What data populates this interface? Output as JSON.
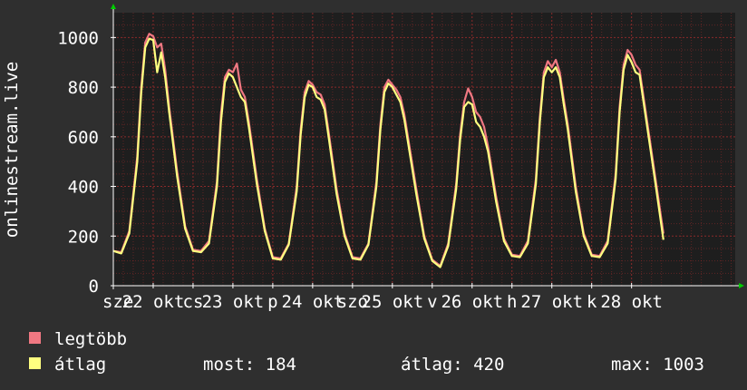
{
  "chart_data": {
    "type": "line",
    "ylabel": "onlinestream.live",
    "ylim": [
      0,
      1100
    ],
    "yticks": [
      0,
      200,
      400,
      600,
      800,
      1000
    ],
    "xlim": [
      0,
      7.8
    ],
    "x_tick_labels": [
      {
        "x": 0.0,
        "label": "sze"
      },
      {
        "x": 0.5,
        "label": "22 okt"
      },
      {
        "x": 1.0,
        "label": "cs"
      },
      {
        "x": 1.5,
        "label": "23 okt"
      },
      {
        "x": 2.0,
        "label": "p"
      },
      {
        "x": 2.5,
        "label": "24 okt"
      },
      {
        "x": 3.0,
        "label": "szo"
      },
      {
        "x": 3.5,
        "label": "25 okt"
      },
      {
        "x": 4.0,
        "label": "v"
      },
      {
        "x": 4.5,
        "label": "26 okt"
      },
      {
        "x": 5.0,
        "label": "h"
      },
      {
        "x": 5.5,
        "label": "27 okt"
      },
      {
        "x": 6.0,
        "label": "k"
      },
      {
        "x": 6.5,
        "label": "28 okt"
      }
    ],
    "grid": true,
    "colors": {
      "background": "#2f2f2f",
      "plot": "#1e1e1e",
      "grid": "#8a2a2a",
      "axis": "#ffffff",
      "arrow": "#00cc00"
    },
    "series": [
      {
        "name": "legtöbb",
        "color": "#f07882",
        "x": [
          0,
          0.1,
          0.2,
          0.3,
          0.35,
          0.4,
          0.45,
          0.5,
          0.55,
          0.6,
          0.65,
          0.7,
          0.8,
          0.9,
          1.0,
          1.1,
          1.2,
          1.3,
          1.35,
          1.4,
          1.45,
          1.5,
          1.55,
          1.6,
          1.65,
          1.7,
          1.8,
          1.9,
          2.0,
          2.1,
          2.2,
          2.3,
          2.35,
          2.4,
          2.45,
          2.5,
          2.55,
          2.6,
          2.65,
          2.7,
          2.8,
          2.9,
          3.0,
          3.1,
          3.2,
          3.3,
          3.35,
          3.4,
          3.45,
          3.5,
          3.55,
          3.6,
          3.65,
          3.7,
          3.8,
          3.9,
          4.0,
          4.1,
          4.2,
          4.3,
          4.35,
          4.4,
          4.45,
          4.5,
          4.55,
          4.6,
          4.65,
          4.7,
          4.8,
          4.9,
          5.0,
          5.1,
          5.2,
          5.3,
          5.35,
          5.4,
          5.45,
          5.5,
          5.55,
          5.6,
          5.65,
          5.7,
          5.8,
          5.9,
          6.0,
          6.1,
          6.2,
          6.3,
          6.35,
          6.4,
          6.45,
          6.5,
          6.55,
          6.6,
          6.65,
          6.7,
          6.8,
          6.9
        ],
        "y": [
          140,
          135,
          220,
          520,
          800,
          980,
          1015,
          1005,
          960,
          975,
          870,
          720,
          460,
          240,
          145,
          140,
          180,
          420,
          690,
          840,
          870,
          860,
          895,
          790,
          760,
          660,
          430,
          230,
          115,
          110,
          170,
          400,
          630,
          780,
          825,
          810,
          780,
          770,
          730,
          620,
          390,
          210,
          115,
          110,
          170,
          420,
          650,
          800,
          830,
          810,
          790,
          760,
          690,
          590,
          390,
          200,
          105,
          80,
          170,
          410,
          610,
          740,
          795,
          760,
          700,
          680,
          640,
          560,
          360,
          190,
          125,
          120,
          180,
          430,
          680,
          860,
          905,
          880,
          910,
          860,
          750,
          650,
          400,
          210,
          125,
          120,
          180,
          450,
          720,
          890,
          950,
          930,
          890,
          870,
          760,
          650,
          430,
          210
        ]
      },
      {
        "name": "átlag",
        "color": "#ffff80",
        "x": [
          0,
          0.1,
          0.2,
          0.3,
          0.35,
          0.4,
          0.45,
          0.5,
          0.55,
          0.6,
          0.65,
          0.7,
          0.8,
          0.9,
          1.0,
          1.1,
          1.2,
          1.3,
          1.35,
          1.4,
          1.45,
          1.5,
          1.55,
          1.6,
          1.65,
          1.7,
          1.8,
          1.9,
          2.0,
          2.1,
          2.2,
          2.3,
          2.35,
          2.4,
          2.45,
          2.5,
          2.55,
          2.6,
          2.65,
          2.7,
          2.8,
          2.9,
          3.0,
          3.1,
          3.2,
          3.3,
          3.35,
          3.4,
          3.45,
          3.5,
          3.55,
          3.6,
          3.65,
          3.7,
          3.8,
          3.9,
          4.0,
          4.1,
          4.2,
          4.3,
          4.35,
          4.4,
          4.45,
          4.5,
          4.55,
          4.6,
          4.65,
          4.7,
          4.8,
          4.9,
          5.0,
          5.1,
          5.2,
          5.3,
          5.35,
          5.4,
          5.45,
          5.5,
          5.55,
          5.6,
          5.65,
          5.7,
          5.8,
          5.9,
          6.0,
          6.1,
          6.2,
          6.3,
          6.35,
          6.4,
          6.45,
          6.5,
          6.55,
          6.6,
          6.65,
          6.7,
          6.8,
          6.9
        ],
        "y": [
          140,
          130,
          210,
          500,
          780,
          960,
          995,
          990,
          860,
          940,
          840,
          700,
          440,
          230,
          140,
          135,
          170,
          400,
          660,
          820,
          855,
          840,
          800,
          760,
          740,
          640,
          410,
          220,
          110,
          105,
          165,
          380,
          610,
          760,
          810,
          800,
          760,
          750,
          710,
          600,
          370,
          200,
          110,
          105,
          165,
          400,
          630,
          780,
          815,
          800,
          770,
          740,
          670,
          570,
          370,
          190,
          100,
          75,
          160,
          390,
          590,
          720,
          740,
          730,
          660,
          640,
          600,
          540,
          340,
          180,
          120,
          115,
          170,
          410,
          660,
          840,
          880,
          860,
          880,
          840,
          730,
          630,
          380,
          200,
          120,
          115,
          170,
          430,
          700,
          870,
          930,
          900,
          860,
          850,
          740,
          630,
          410,
          185
        ]
      }
    ]
  },
  "legend": [
    {
      "label": "legtöbb",
      "color": "#f07882"
    },
    {
      "label": "átlag",
      "color": "#ffff80"
    }
  ],
  "stats": {
    "most": "most: 184",
    "atlag": "átlag: 420",
    "max": "max: 1003"
  }
}
